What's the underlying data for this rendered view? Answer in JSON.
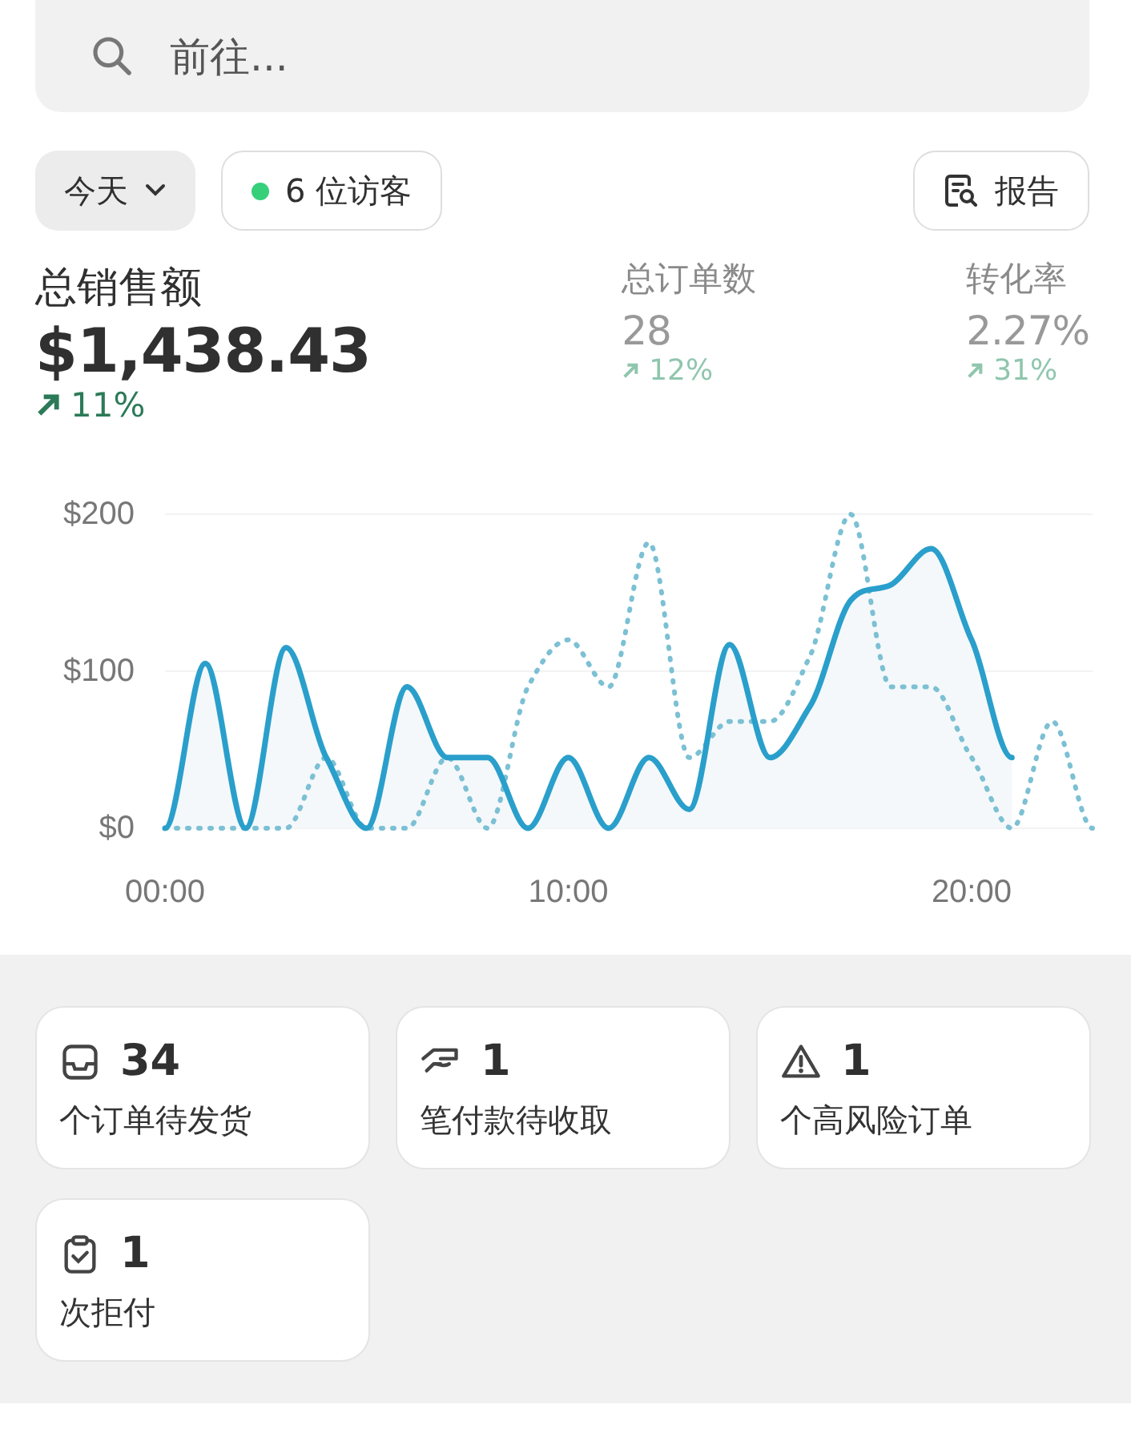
{
  "search": {
    "placeholder": "前往..."
  },
  "toolbar": {
    "date_button": "今天",
    "visitors": "6 位访客",
    "live": true,
    "report_button": "报告"
  },
  "metrics": [
    {
      "kind": "primary",
      "label": "总销售额",
      "value": "$1,438.43",
      "change": "11%"
    },
    {
      "kind": "secondary",
      "label": "总订单数",
      "value": "28",
      "change": "12%"
    },
    {
      "kind": "secondary",
      "label": "转化率",
      "value": "2.27%",
      "change": "31%"
    }
  ],
  "chart_data": {
    "type": "line",
    "x": [
      0,
      1,
      2,
      3,
      4,
      5,
      6,
      7,
      8,
      9,
      10,
      11,
      12,
      13,
      14,
      15,
      16,
      17,
      18,
      19,
      20,
      21,
      22,
      23
    ],
    "xlim": [
      0,
      23
    ],
    "ylim": [
      0,
      200
    ],
    "xticks": [
      {
        "value": 0,
        "label": "00:00"
      },
      {
        "value": 10,
        "label": "10:00"
      },
      {
        "value": 20,
        "label": "20:00"
      }
    ],
    "yticks": [
      {
        "value": 0,
        "label": "$0"
      },
      {
        "value": 100,
        "label": "$100"
      },
      {
        "value": 200,
        "label": "$200"
      }
    ],
    "series": [
      {
        "color": "#2a9fcb",
        "line_style": "solid",
        "values": [
          0,
          105,
          0,
          115,
          45,
          0,
          90,
          45,
          45,
          0,
          45,
          0,
          45,
          12,
          117,
          45,
          78,
          145,
          155,
          178,
          120,
          45,
          null,
          null
        ]
      },
      {
        "color": "#7cc0d4",
        "line_style": "dotted",
        "values": [
          0,
          0,
          0,
          0,
          45,
          0,
          0,
          45,
          0,
          90,
          120,
          90,
          182,
          45,
          68,
          68,
          110,
          200,
          90,
          90,
          45,
          0,
          68,
          0
        ]
      }
    ]
  },
  "tasks": [
    {
      "kind": "shipping",
      "count": "34",
      "label": "个订单待发货"
    },
    {
      "kind": "payment",
      "count": "1",
      "label": "笔付款待收取"
    },
    {
      "kind": "risk",
      "count": "1",
      "label": "个高风险订单"
    },
    {
      "kind": "chargeback",
      "count": "1",
      "label": "次拒付"
    }
  ]
}
